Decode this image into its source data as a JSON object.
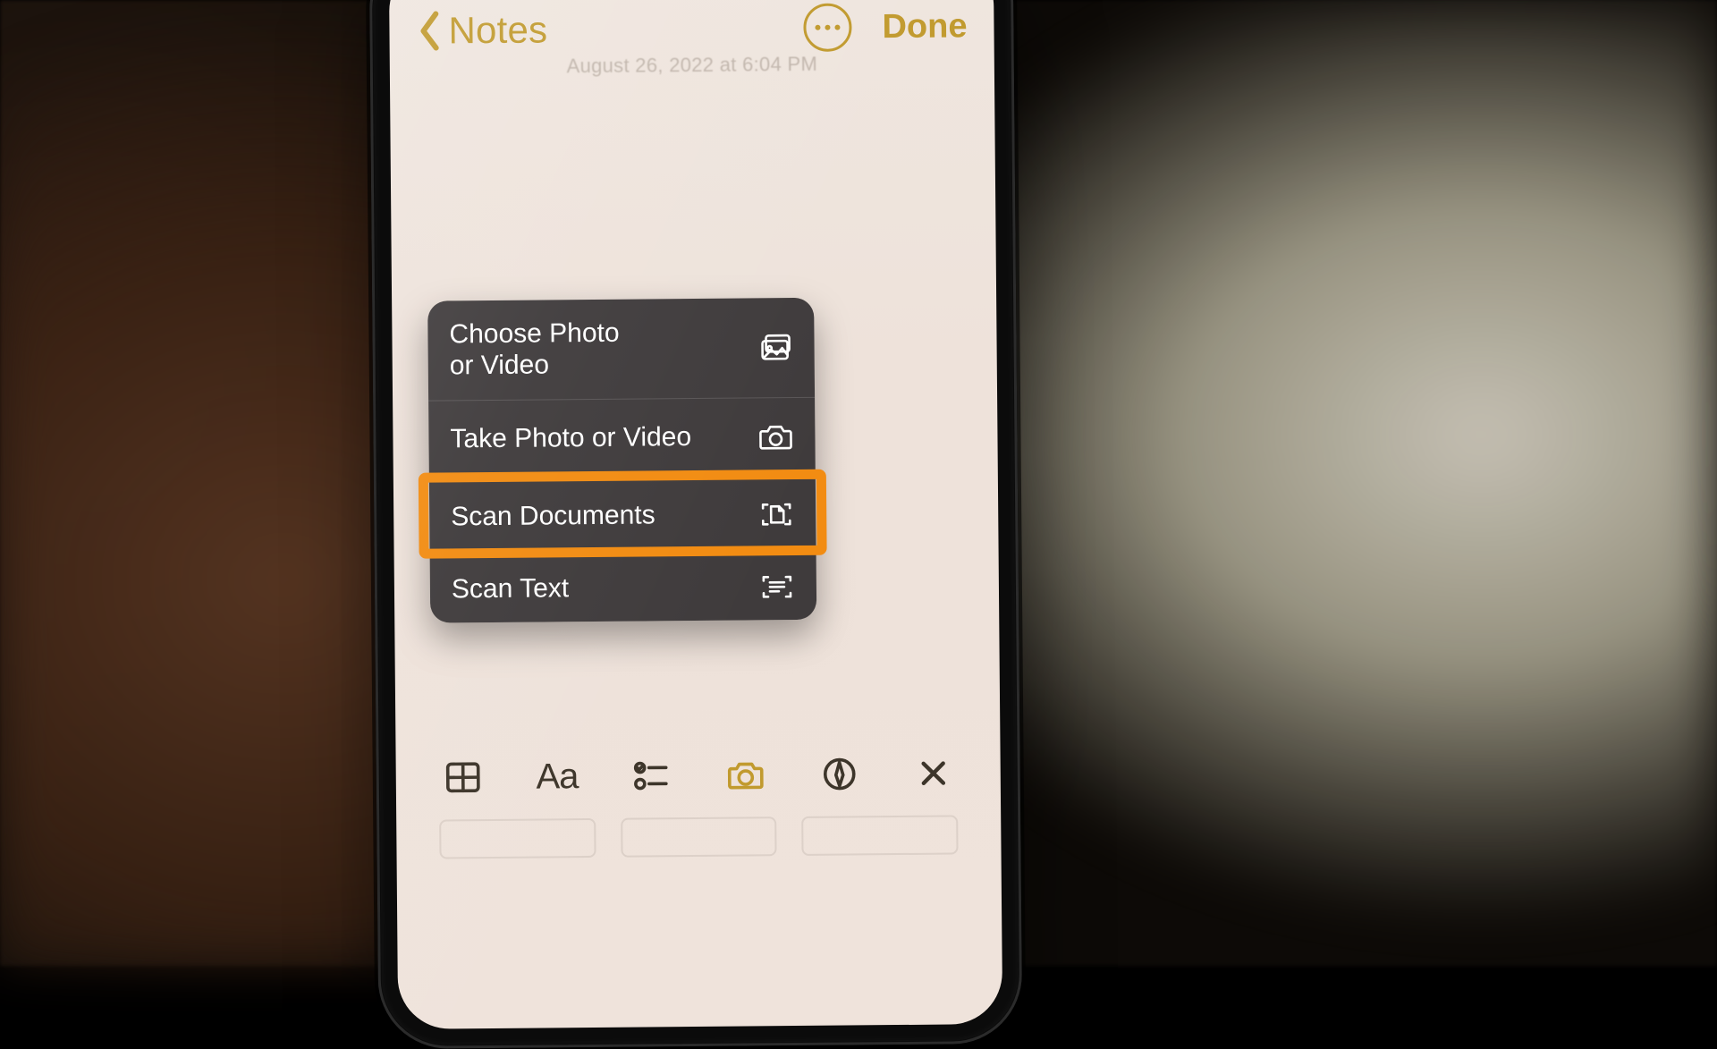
{
  "accent_color": "#c19a2e",
  "highlight_color": "#f28c12",
  "navbar": {
    "back_label": "Notes",
    "done_label": "Done"
  },
  "note": {
    "date_line": "August 26, 2022 at 6:04 PM"
  },
  "attachment_menu": {
    "items": [
      {
        "label": "Choose Photo\nor Video",
        "icon": "photo-stack-icon"
      },
      {
        "label": "Take Photo or Video",
        "icon": "camera-icon"
      },
      {
        "label": "Scan Documents",
        "icon": "scan-doc-icon"
      },
      {
        "label": "Scan Text",
        "icon": "scan-text-icon"
      }
    ],
    "highlighted_index": 2
  },
  "keyboard_toolbar": {
    "buttons": [
      {
        "name": "table-button",
        "icon": "table-icon"
      },
      {
        "name": "text-format-button",
        "icon": "aa-icon"
      },
      {
        "name": "checklist-button",
        "icon": "checklist-icon"
      },
      {
        "name": "camera-button",
        "icon": "camera-icon"
      },
      {
        "name": "markup-button",
        "icon": "markup-icon"
      },
      {
        "name": "dismiss-button",
        "icon": "close-icon"
      }
    ]
  }
}
